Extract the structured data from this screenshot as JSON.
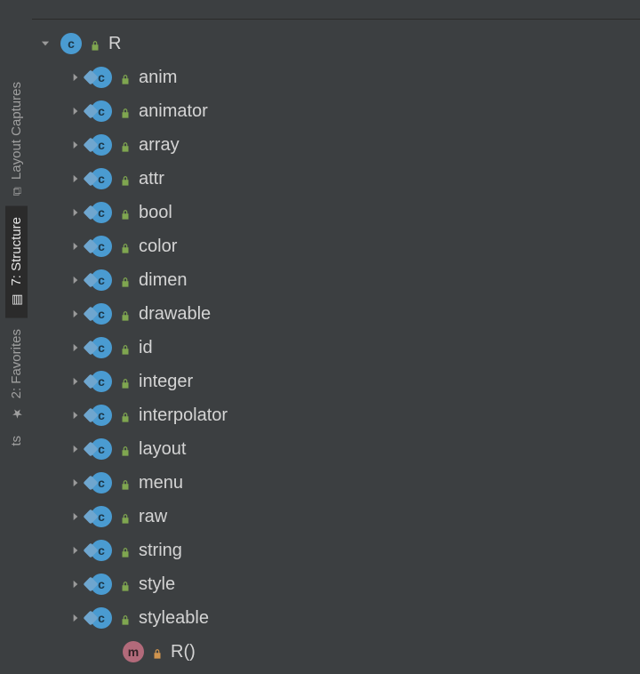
{
  "rail": {
    "tabs": [
      {
        "label": "Layout Captures"
      },
      {
        "label": "7: Structure"
      },
      {
        "label": "2: Favorites"
      }
    ]
  },
  "tree": {
    "root": {
      "label": "R",
      "badge_letter": "c"
    },
    "children": [
      {
        "label": "anim"
      },
      {
        "label": "animator"
      },
      {
        "label": "array"
      },
      {
        "label": "attr"
      },
      {
        "label": "bool"
      },
      {
        "label": "color"
      },
      {
        "label": "dimen"
      },
      {
        "label": "drawable"
      },
      {
        "label": "id"
      },
      {
        "label": "integer"
      },
      {
        "label": "interpolator"
      },
      {
        "label": "layout"
      },
      {
        "label": "menu"
      },
      {
        "label": "raw"
      },
      {
        "label": "string"
      },
      {
        "label": "style"
      },
      {
        "label": "styleable"
      }
    ],
    "method": {
      "label": "R()",
      "badge_letter": "m"
    }
  }
}
